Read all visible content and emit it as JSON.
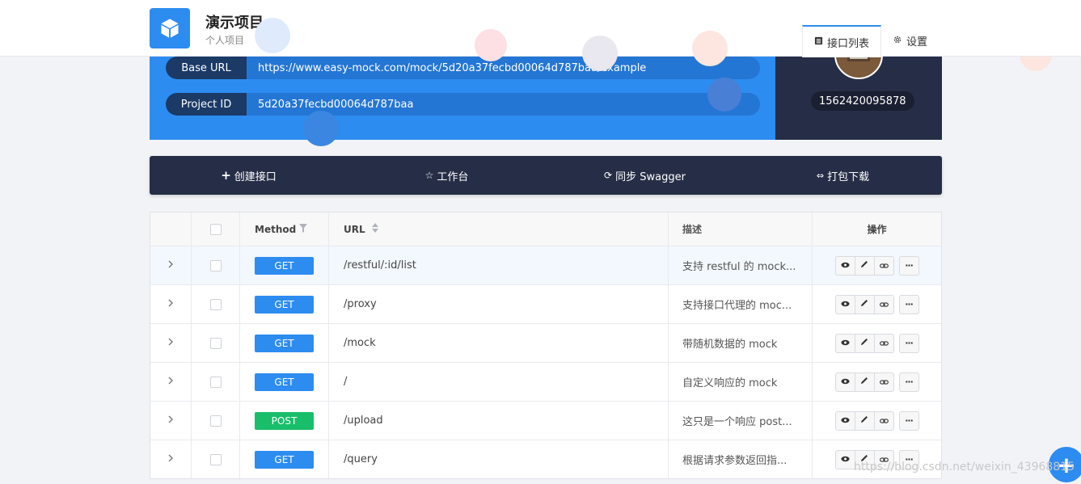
{
  "header": {
    "project_title": "演示项目",
    "project_subtitle": "个人项目",
    "tabs": [
      {
        "label": "接口列表",
        "icon": "list-icon",
        "active": true
      },
      {
        "label": "设置",
        "icon": "gear-icon",
        "active": false
      }
    ]
  },
  "info": {
    "base_url_label": "Base URL",
    "base_url_value": "https://www.easy-mock.com/mock/5d20a37fecbd00064d787baa/example",
    "project_id_label": "Project ID",
    "project_id_value": "5d20a37fecbd00064d787baa"
  },
  "owner": {
    "id": "1562420095878"
  },
  "toolbar": {
    "create": "创建接口",
    "workbench": "工作台",
    "sync": "同步 Swagger",
    "download": "打包下载"
  },
  "table": {
    "headers": {
      "method": "Method",
      "url": "URL",
      "desc": "描述",
      "ops": "操作"
    },
    "rows": [
      {
        "method": "GET",
        "url": "/restful/:id/list",
        "desc": "支持 restful 的 mock..."
      },
      {
        "method": "GET",
        "url": "/proxy",
        "desc": "支持接口代理的 moc..."
      },
      {
        "method": "GET",
        "url": "/mock",
        "desc": "带随机数据的 mock"
      },
      {
        "method": "GET",
        "url": "/",
        "desc": "自定义响应的 mock"
      },
      {
        "method": "POST",
        "url": "/upload",
        "desc": "这只是一个响应 post..."
      },
      {
        "method": "GET",
        "url": "/query",
        "desc": "根据请求参数返回指..."
      }
    ]
  },
  "colors": {
    "primary": "#2d8cf0",
    "dark": "#262e47",
    "get": "#2d8cf0",
    "post": "#19be6b"
  },
  "watermark": "https://blog.csdn.net/weixin_43968815"
}
